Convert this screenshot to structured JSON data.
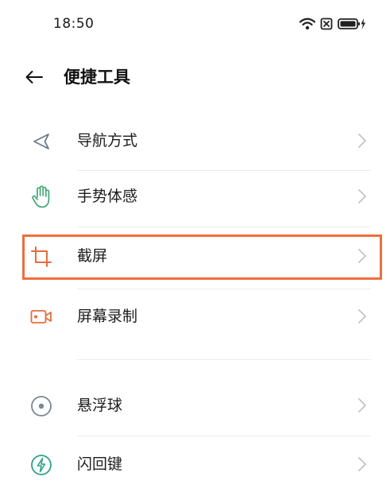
{
  "status_bar": {
    "time": "18:50"
  },
  "header": {
    "title": "便捷工具"
  },
  "items": [
    {
      "label": "导航方式",
      "icon": "navigation-triangle-icon"
    },
    {
      "label": "手势体感",
      "icon": "hand-gesture-icon"
    },
    {
      "label": "截屏",
      "icon": "crop-screenshot-icon"
    },
    {
      "label": "屏幕录制",
      "icon": "video-record-icon"
    },
    {
      "label": "悬浮球",
      "icon": "floating-ball-icon"
    },
    {
      "label": "闪回键",
      "icon": "flashback-key-icon"
    }
  ],
  "colors": {
    "highlight_border": "#ee6f3b",
    "gesture_icon": "#3fa877",
    "crop_icon": "#e56b3a",
    "record_icon": "#e56b3a",
    "flashback_icon": "#2aa48a",
    "nav_icon": "#6b7a8c",
    "ball_icon": "#7b8794"
  }
}
